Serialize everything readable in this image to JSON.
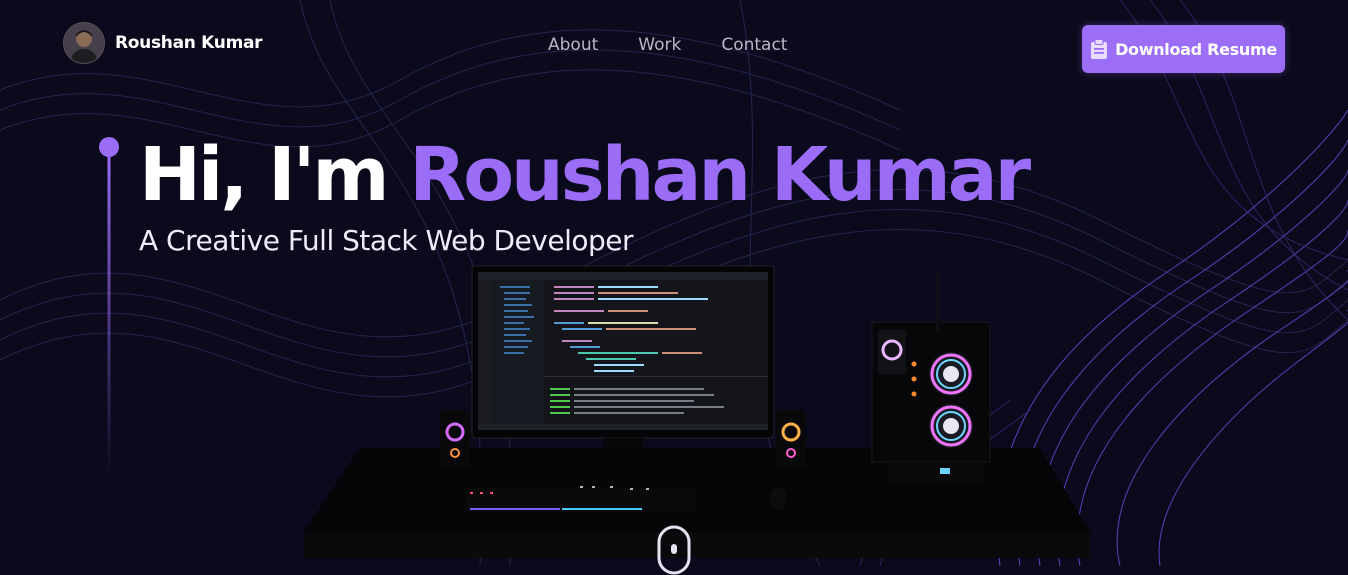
{
  "brand": {
    "name": "Roushan Kumar"
  },
  "nav": {
    "links": [
      "About",
      "Work",
      "Contact"
    ]
  },
  "resume_button": {
    "label": "Download Resume",
    "icon": "clipboard-icon"
  },
  "hero": {
    "greeting": "Hi, I'm ",
    "name": "Roushan Kumar",
    "subtitle": "A Creative Full Stack Web Developer"
  },
  "colors": {
    "background": "#0b0a1c",
    "accent": "#9b6cf6",
    "button": "#9c6ef7",
    "nav_text": "#b9b7c6"
  }
}
